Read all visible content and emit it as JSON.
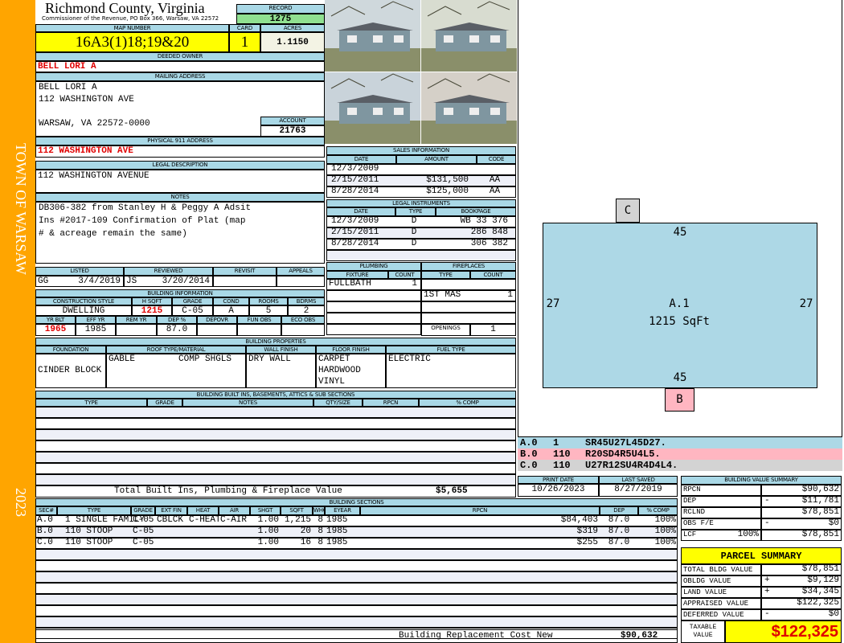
{
  "side": {
    "town": "TOWN OF WARSAW",
    "year": "2023"
  },
  "header": {
    "county": "Richmond County, Virginia",
    "subtitle": "Commissioner of the Revenue, PO Box 366, Warsaw, VA 22572",
    "record_label": "RECORD",
    "record": "1275"
  },
  "map": {
    "map_label": "MAP NUMBER",
    "map_number": "16A3(1)18;19&20",
    "card_label": "CARD",
    "card": "1",
    "acres_label": "ACRES",
    "acres": "1.1150"
  },
  "owner": {
    "label": "DEEDED OWNER",
    "name": "BELL LORI A"
  },
  "mailing": {
    "label": "MAILING ADDRESS",
    "line1": "BELL LORI A",
    "line2": "112 WASHINGTON AVE",
    "line3": "WARSAW, VA 22572-0000",
    "account_label": "ACCOUNT",
    "account": "21763"
  },
  "physical": {
    "label": "PHYSICAL 911 ADDRESS",
    "value": "112 WASHINGTON AVE"
  },
  "legal": {
    "label": "LEGAL DESCRIPTION",
    "value": "112 WASHINGTON AVENUE"
  },
  "notes": {
    "label": "NOTES",
    "lines": [
      "DB306-382 from Stanley H & Peggy A Adsit",
      "Ins #2017-109 Confirmation of Plat (map",
      "# & acreage remain the same)"
    ]
  },
  "review": {
    "headers": [
      "LISTED",
      "REVIEWED",
      "REVISIT",
      "APPEALS"
    ],
    "listed_by": "GG",
    "listed_date": "3/4/2019",
    "reviewed_by": "JS",
    "reviewed_date": "3/20/2014"
  },
  "building_info": {
    "label": "BUILDING INFORMATION",
    "headers1": [
      "CONSTRUCTION STYLE",
      "H SQFT",
      "GRADE",
      "COND",
      "ROOMS",
      "BDRMS"
    ],
    "values1": [
      "DWELLING",
      "1215",
      "C-05",
      "A",
      "5",
      "2"
    ],
    "headers2": [
      "YR BLT",
      "EFF YR",
      "REM YR",
      "DEP %",
      "DEPOVR",
      "FUN OBS",
      "ECO OBS"
    ],
    "values2": [
      "1965",
      "1985",
      "",
      "87.0",
      "",
      "",
      ""
    ]
  },
  "building_props": {
    "label": "BUILDING PROPERTIES",
    "headers": [
      "FOUNDATION",
      "ROOF TYPE/MATERIAL",
      "WALL FINISH",
      "FLOOR FINISH",
      "FUEL TYPE"
    ],
    "foundation": "CINDER BLOCK",
    "roof_type": "GABLE",
    "roof_material": "COMP SHGLS",
    "wall": "DRY WALL",
    "floor": [
      "CARPET",
      "HARDWOOD",
      "VINYL"
    ],
    "fuel": "ELECTRIC"
  },
  "built_ins": {
    "label": "BUILDING BUILT INS, BASEMENTS, ATTICS & SUB SECTIONS",
    "headers": [
      "TYPE",
      "GRADE",
      "NOTES",
      "QTY/SIZE",
      "RPCN",
      "% COMP"
    ],
    "total_label": "Total Built Ins, Plumbing & Fireplace Value",
    "total": "$5,655"
  },
  "sales": {
    "label": "SALES INFORMATION",
    "headers": [
      "DATE",
      "AMOUNT",
      "CODE"
    ],
    "rows": [
      [
        "12/3/2009",
        "",
        ""
      ],
      [
        "2/15/2011",
        "$131,500",
        "AA"
      ],
      [
        "8/28/2014",
        "$125,000",
        "AA"
      ]
    ]
  },
  "instruments": {
    "label": "LEGAL INSTRUMENTS",
    "headers": [
      "DATE",
      "TYPE",
      "BOOKPAGE"
    ],
    "rows": [
      [
        "12/3/2009",
        "D",
        "WB 33 376"
      ],
      [
        "2/15/2011",
        "D",
        "286 848"
      ],
      [
        "8/28/2014",
        "D",
        "306 382"
      ],
      [
        "",
        "",
        ""
      ]
    ]
  },
  "plumbing": {
    "label": "PLUMBING",
    "headers": [
      "FIXTURE",
      "COUNT"
    ],
    "rows": [
      [
        "FULLBATH",
        "1"
      ],
      [
        "",
        ""
      ],
      [
        "",
        ""
      ],
      [
        "",
        ""
      ],
      [
        "",
        ""
      ]
    ]
  },
  "fireplaces": {
    "label": "FIREPLACES",
    "headers": [
      "TYPE",
      "COUNT"
    ],
    "rows": [
      [
        "",
        ""
      ],
      [
        "1ST MAS",
        "1"
      ],
      [
        "",
        ""
      ],
      [
        "",
        ""
      ]
    ],
    "openings_label": "OPENINGS",
    "openings": "1"
  },
  "sketch": {
    "main_label": "A.1",
    "main_area": "1215 SqFt",
    "top": "45",
    "bottom": "45",
    "left": "27",
    "right": "27",
    "c_label": "C",
    "b_label": "B",
    "colors": {
      "main": "#add8e6",
      "b": "#ffb6c1",
      "c": "#d3d3d3"
    }
  },
  "codes": [
    [
      "A.0",
      "1",
      "SR45U27L45D27."
    ],
    [
      "B.0",
      "110",
      "R20SD4R5U4L5."
    ],
    [
      "C.0",
      "110",
      "U27R12SU4R4D4L4."
    ]
  ],
  "dates": {
    "print_label": "PRINT DATE",
    "print": "10/26/2023",
    "saved_label": "LAST SAVED",
    "saved": "8/27/2019"
  },
  "sections": {
    "label": "BUILDING SECTIONS",
    "headers": [
      "SEC#",
      "TYPE",
      "GRADE",
      "EXT FIN",
      "HEAT",
      "AIR",
      "SHGT",
      "SQFT",
      "WHGT",
      "EYEAR",
      "RPCN",
      "DEP",
      "% COMP"
    ],
    "rows": [
      [
        "A.0",
        "1 SINGLE FAMILY",
        "C-05",
        "CBLCK",
        "C-HEAT",
        "C-AIR",
        "1.00",
        "1,215",
        "8",
        "1985",
        "$84,403",
        "87.0",
        "100%"
      ],
      [
        "B.0",
        "110 STOOP",
        "C-05",
        "",
        "",
        "",
        "1.00",
        "20",
        "8",
        "1985",
        "$319",
        "87.0",
        "100%"
      ],
      [
        "C.0",
        "110 STOOP",
        "C-05",
        "",
        "",
        "",
        "1.00",
        "16",
        "8",
        "1985",
        "$255",
        "87.0",
        "100%"
      ]
    ],
    "replacement_label": "Building Replacement Cost New",
    "replacement": "$90,632"
  },
  "value_summary": {
    "label": "BUILDING VALUE SUMMARY",
    "rows": [
      [
        "RPCN",
        "",
        "",
        "$90,632"
      ],
      [
        "DEP",
        "",
        "-",
        "$11,781"
      ],
      [
        "RCLND",
        "",
        "",
        "$78,851"
      ],
      [
        "OBS F/E",
        "",
        "-",
        "$0"
      ],
      [
        "LCF",
        "100%",
        "",
        "$78,851"
      ]
    ]
  },
  "parcel": {
    "title": "PARCEL SUMMARY",
    "rows": [
      [
        "TOTAL BLDG VALUE",
        "",
        "$78,851"
      ],
      [
        "OBLDG VALUE",
        "+",
        "$9,129"
      ],
      [
        "LAND VALUE",
        "+",
        "$34,345"
      ],
      [
        "APPRAISED VALUE",
        "",
        "$122,325"
      ],
      [
        "DEFERRED VALUE",
        "-",
        "$0"
      ]
    ],
    "taxable_label": "TAXABLE\nVALUE",
    "taxable": "$122,325"
  }
}
